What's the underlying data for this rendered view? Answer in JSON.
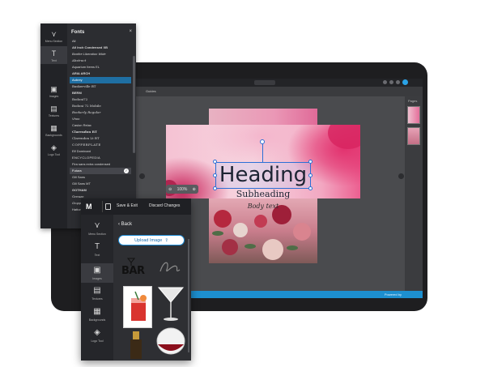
{
  "editor": {
    "guides_label": "Guides",
    "pages_label": "Pages",
    "zoom_minus": "⊖",
    "zoom_value": "100%",
    "zoom_plus": "⊕",
    "powered_by": "Powered by"
  },
  "canvas": {
    "heading": "Heading",
    "subheading": "Subheading",
    "body_text": "Body text"
  },
  "fonts_panel": {
    "title": "Fonts",
    "close_glyph": "×",
    "rail": [
      {
        "icon": "⋎",
        "label": "Menu Section"
      },
      {
        "icon": "T",
        "label": "Text"
      },
      {
        "icon": "▣",
        "label": "Images"
      },
      {
        "icon": "▤",
        "label": "Textures"
      },
      {
        "icon": "▦",
        "label": "Backgrounds"
      },
      {
        "icon": "◈",
        "label": "Logo Tool"
      }
    ],
    "fonts": [
      "All",
      "All Inch Condensed XB",
      "Bonfire Liberation Wide",
      "Abstract",
      "Aquarium Items EL",
      "ARIA ARCH",
      "Aubrey",
      "Baskerville BT",
      "BERM",
      "Bodoni72",
      "Bodoni 72 Mobile",
      "Bookerly Regular",
      "Vhoo",
      "Caslon Relax",
      "Clarendon BT",
      "Clarendon Lt BT",
      "COPPERPLATE",
      "Elf Dominant",
      "ENCYCLOPEDIA",
      "Fira sans extra condensed",
      "Futura",
      "Gill Sans",
      "Gill Sans MT",
      "GOTHAM",
      "Grenze",
      "Gruppo",
      "Hatton"
    ],
    "selected_font": "Aubrey",
    "checked_font": "Futura",
    "check_glyph": "✓"
  },
  "images_panel": {
    "logo": "M",
    "save_label": "Save & Exit",
    "discard_label": "Discard Changes",
    "back_label": "Back",
    "upload_label": "Upload Image",
    "rail": [
      {
        "icon": "⋎",
        "label": "Menu Section"
      },
      {
        "icon": "T",
        "label": "Text"
      },
      {
        "icon": "▣",
        "label": "Images"
      },
      {
        "icon": "▤",
        "label": "Textures"
      },
      {
        "icon": "▦",
        "label": "Backgrounds"
      },
      {
        "icon": "◈",
        "label": "Logo Tool"
      }
    ],
    "thumb_bar_text": "BAR"
  },
  "colors": {
    "accent": "#1c8ad4",
    "selection": "#2b6fd6",
    "panel_dark": "#2c2d31"
  }
}
